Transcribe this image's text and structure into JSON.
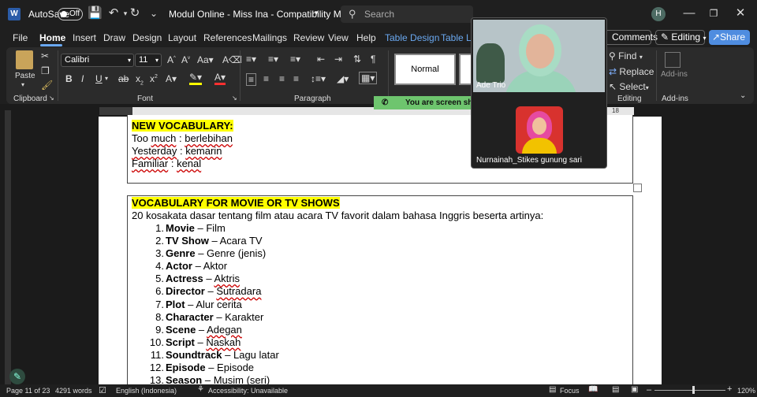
{
  "titlebar": {
    "autosave_label": "AutoSave",
    "autosave_state": "Off",
    "doc_title": "Modul Online  -  Miss Ina  -  Compatibility M...",
    "search_placeholder": "Search",
    "avatar_initial": "H"
  },
  "tabs": [
    "File",
    "Home",
    "Insert",
    "Draw",
    "Design",
    "Layout",
    "References",
    "Mailings",
    "Review",
    "View",
    "Help",
    "Table Design",
    "Table Lay"
  ],
  "active_tab": "Home",
  "header_buttons": {
    "comments": "Comments",
    "editing": "Editing",
    "share": "Share"
  },
  "ribbon": {
    "paste": "Paste",
    "font_name": "Calibri",
    "font_size": "11",
    "styles": [
      "Normal"
    ],
    "find": "Find",
    "replace": "Replace",
    "select": "Select",
    "addins": "Add-ins",
    "groups": {
      "clipboard": "Clipboard",
      "font": "Font",
      "paragraph": "Paragraph",
      "editing": "Editing",
      "addins": "Add-ins"
    }
  },
  "ruler": {
    "mark_18": "18"
  },
  "document": {
    "box1": {
      "heading": "NEW VOCABULARY:",
      "lines": [
        {
          "a": "Too ",
          "b": "much",
          "c": " : ",
          "d": "berlebihan"
        },
        {
          "a": "",
          "b": "Yesterday",
          "c": " : ",
          "d": "kemarin"
        },
        {
          "a": "",
          "b": "Familiar",
          "c": " : ",
          "d": "kenal"
        }
      ]
    },
    "box2": {
      "heading": "VOCABULARY FOR MOVIE OR TV SHOWS",
      "intro": "20 kosakata dasar tentang film atau acara TV favorit dalam bahasa Inggris beserta artinya:",
      "items": [
        {
          "n": "1.",
          "term": "Movie",
          "meaning": "Film"
        },
        {
          "n": "2.",
          "term": "TV Show",
          "meaning": "Acara TV"
        },
        {
          "n": "3.",
          "term": "Genre",
          "meaning": "Genre (jenis)"
        },
        {
          "n": "4.",
          "term": "Actor",
          "meaning": "Aktor"
        },
        {
          "n": "5.",
          "term": "Actress",
          "meaning": "Aktris"
        },
        {
          "n": "6.",
          "term": "Director",
          "meaning": "Sutradara"
        },
        {
          "n": "7.",
          "term": "Plot",
          "meaning": "Alur cerita"
        },
        {
          "n": "8.",
          "term": "Character",
          "meaning": "Karakter"
        },
        {
          "n": "9.",
          "term": "Scene",
          "meaning": "Adegan"
        },
        {
          "n": "10.",
          "term": "Script",
          "meaning": "Naskah"
        },
        {
          "n": "11.",
          "term": "Soundtrack",
          "meaning": "Lagu latar"
        },
        {
          "n": "12.",
          "term": "Episode",
          "meaning": "Episode"
        },
        {
          "n": "13.",
          "term": "Season",
          "meaning": "Musim (seri)"
        }
      ]
    }
  },
  "call": {
    "participant1": "Ade Trio",
    "participant2": "Nurnainah_Stikes gunung sari",
    "banner": "You are screen shar"
  },
  "status": {
    "page": "Page 11 of 23",
    "words": "4291 words",
    "language": "English (Indonesia)",
    "accessibility": "Accessibility: Unavailable",
    "focus": "Focus",
    "zoom": "120%"
  }
}
